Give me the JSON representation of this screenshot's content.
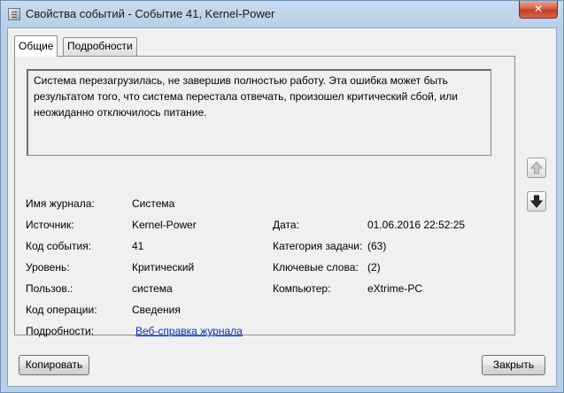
{
  "window": {
    "title": "Свойства событий - Событие 41, Kernel-Power",
    "close_glyph": "✕"
  },
  "tabs": [
    {
      "label": "Общие",
      "active": true
    },
    {
      "label": "Подробности",
      "active": false
    }
  ],
  "description": "Система перезагрузилась, не завершив полностью работу. Эта ошибка может быть результатом того, что система перестала отвечать, произошел критический сбой, или неожиданно отключилось питание.",
  "fields": {
    "log_name": {
      "label": "Имя журнала:",
      "value": "Система"
    },
    "source": {
      "label": "Источник:",
      "value": "Kernel-Power"
    },
    "event_id": {
      "label": "Код события:",
      "value": "41"
    },
    "level": {
      "label": "Уровень:",
      "value": "Критический"
    },
    "user": {
      "label": "Пользов.:",
      "value": "система"
    },
    "opcode": {
      "label": "Код операции:",
      "value": "Сведения"
    },
    "details": {
      "label": "Подробности:",
      "value": "Веб-справка журнала"
    },
    "date": {
      "label": "Дата:",
      "value": "01.06.2016 22:52:25"
    },
    "task_category": {
      "label": "Категория задачи:",
      "value": "(63)"
    },
    "keywords": {
      "label": "Ключевые слова:",
      "value": "(2)"
    },
    "computer": {
      "label": "Компьютер:",
      "value": "eXtrime-PC"
    }
  },
  "buttons": {
    "copy": "Копировать",
    "close": "Закрыть"
  },
  "icons": {
    "up": "arrow-up-icon",
    "down": "arrow-down-icon"
  }
}
